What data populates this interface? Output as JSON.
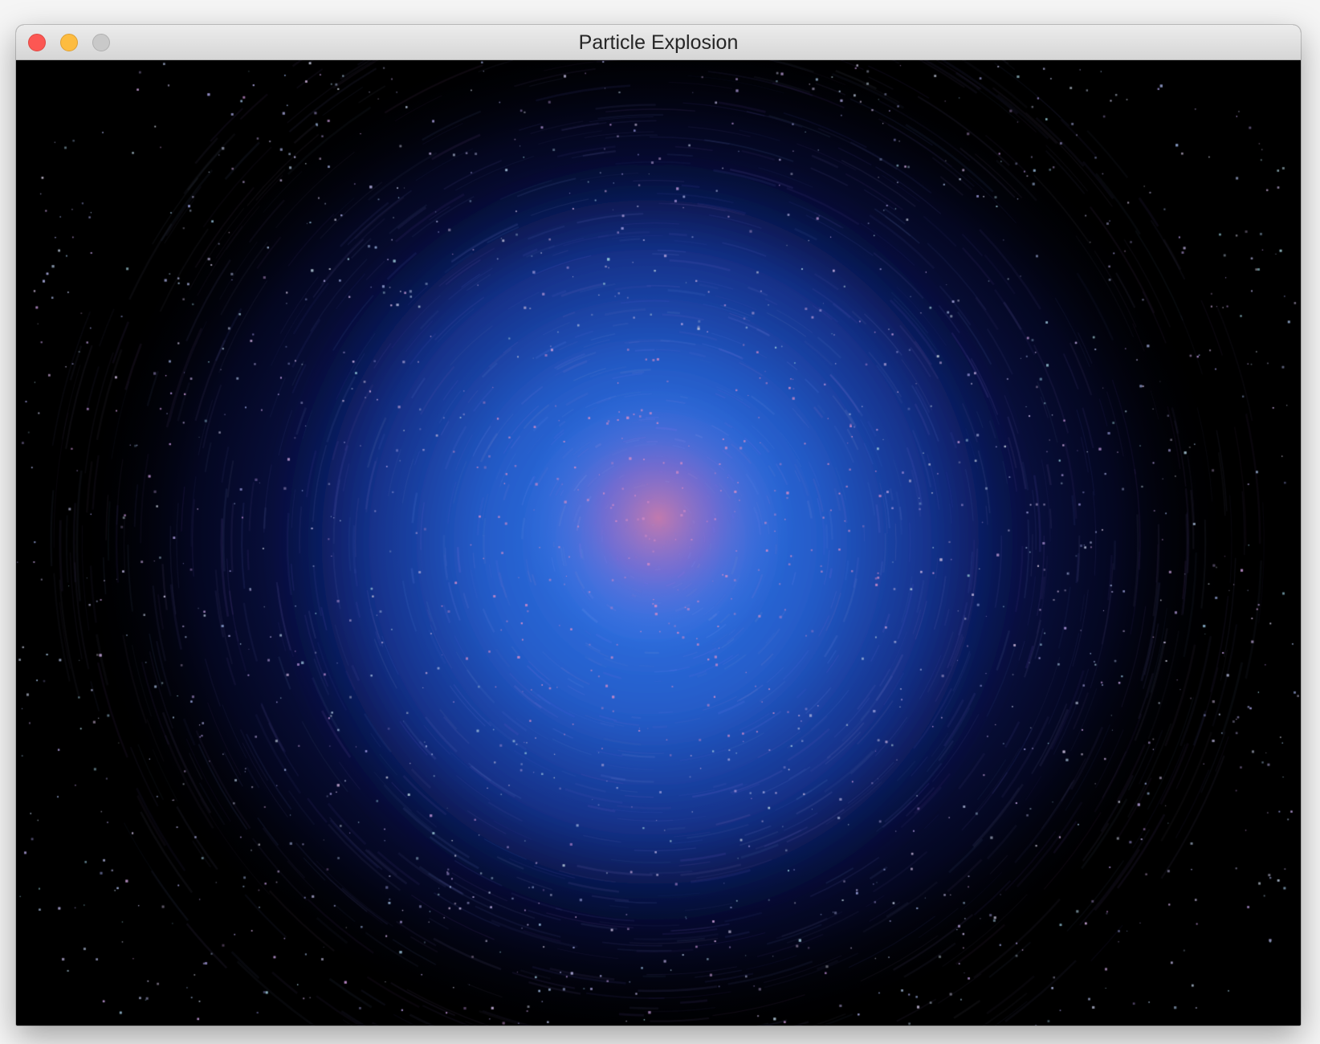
{
  "window": {
    "title": "Particle Explosion"
  },
  "controls": {
    "close": "close-icon",
    "minimize": "minimize-icon",
    "zoom": "zoom-icon"
  },
  "colors": {
    "background": "#000000",
    "core": "#d07aa8",
    "inner_glow": "#2a6fe0",
    "mid_glow": "#1a3aa8",
    "outer_glow": "#0a0f3a"
  }
}
